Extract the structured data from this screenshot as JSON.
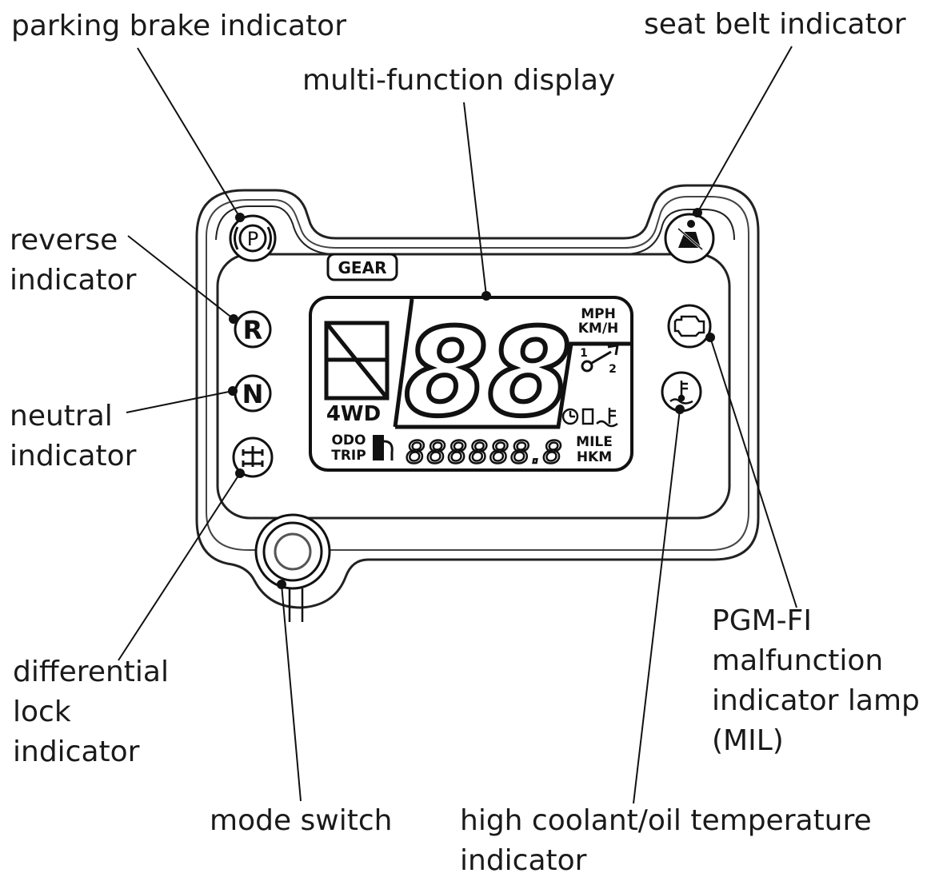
{
  "labels": {
    "parking_brake": "parking brake indicator",
    "seat_belt": "seat belt indicator",
    "multi_function": "multi-function display",
    "reverse_1": "reverse",
    "reverse_2": "indicator",
    "neutral_1": "neutral",
    "neutral_2": "indicator",
    "diff_lock_1": "differential",
    "diff_lock_2": "lock",
    "diff_lock_3": "indicator",
    "mil_1": "PGM-FI",
    "mil_2": "malfunction",
    "mil_3": "indicator lamp",
    "mil_4": "(MIL)",
    "mode_switch": "mode switch",
    "coolant_1": "high coolant/oil temperature",
    "coolant_2": "indicator"
  },
  "panel": {
    "gear_badge": "GEAR",
    "speed_digits": "88",
    "speed_unit_1": "MPH",
    "speed_unit_2": "KM/H",
    "drive_mode": "4WD",
    "odo": "ODO",
    "trip": "TRIP",
    "odo_digits": "888888.8",
    "dist_unit_1": "MILE",
    "dist_unit_2": "HKM",
    "maint_1": "1",
    "maint_2": "2",
    "reverse_letter": "R",
    "neutral_letter": "N",
    "parking_letter": "P"
  }
}
